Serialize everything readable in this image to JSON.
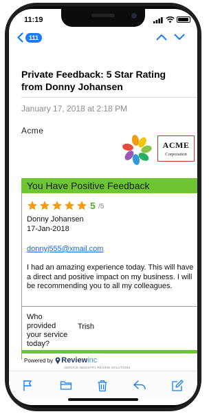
{
  "status_bar": {
    "time": "11:19"
  },
  "navigation": {
    "back_count": "111"
  },
  "email": {
    "subject": "Private Feedback: 5 Star Rating from Donny Johansen",
    "date": "January 17, 2018 at 2:18 PM",
    "sender_name": "Acme",
    "logo": {
      "title": "ACME",
      "subtitle": "Corporation"
    }
  },
  "feedback": {
    "banner": "You Have Positive Feedback",
    "rating": 5,
    "score": "5",
    "score_out_of": "/5",
    "reviewer": "Donny Johansen",
    "review_date": "17-Jan-2018",
    "email": "donnyj555@xmail.com",
    "comment": "I had an amazing experience today. This will have a direct and positive impact on my business. I will be recommending you to all my colleagues.",
    "provider_question": "Who provided your service today?",
    "provider_name": "Trish"
  },
  "powered_by": {
    "label": "Powered by",
    "brand": "Review",
    "brand_suffix": "inc",
    "tagline": "SERVICE INDUSTRY REVIEW SOLUTIONS"
  },
  "toolbar": {
    "icons": [
      "flag-icon",
      "folder-icon",
      "trash-icon",
      "reply-icon",
      "compose-icon"
    ]
  },
  "colors": {
    "accent": "#1b7cf5",
    "banner_green": "#6cc531",
    "star_orange": "#f39c12",
    "link_blue": "#1a64d8"
  }
}
